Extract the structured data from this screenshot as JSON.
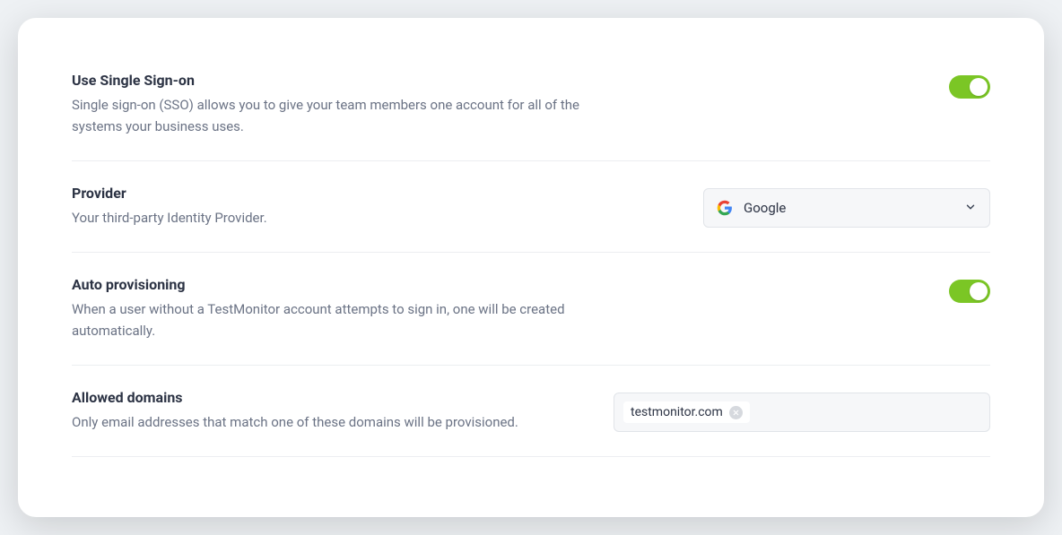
{
  "sso": {
    "title": "Use Single Sign-on",
    "description": "Single sign-on (SSO) allows you to give your team members one account for all of the systems your business uses.",
    "enabled": true
  },
  "provider": {
    "title": "Provider",
    "description": "Your third-party Identity Provider.",
    "selected": "Google",
    "icon": "google-icon"
  },
  "autoProvisioning": {
    "title": "Auto provisioning",
    "description": "When a user without a TestMonitor account attempts to sign in, one will be created automatically.",
    "enabled": true
  },
  "allowedDomains": {
    "title": "Allowed domains",
    "description": "Only email addresses that match one of these domains will be provisioned.",
    "tags": [
      "testmonitor.com"
    ]
  }
}
